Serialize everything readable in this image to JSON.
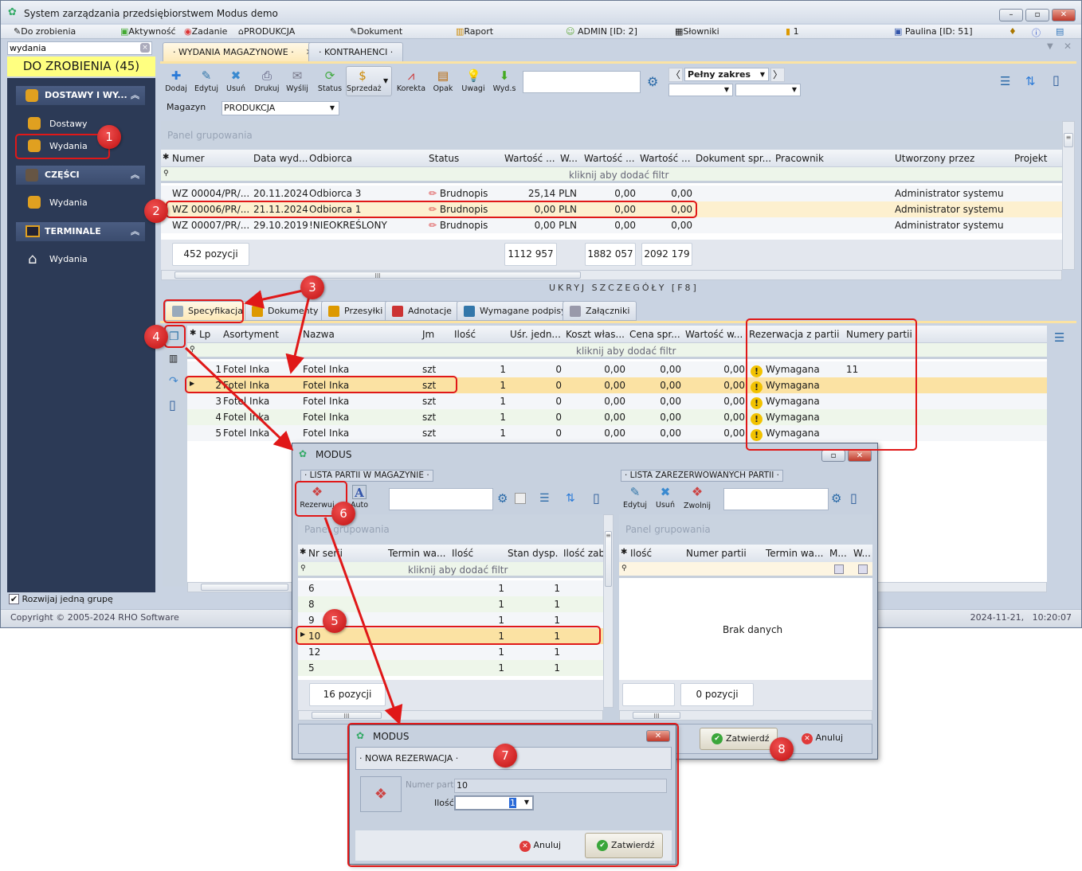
{
  "app": {
    "title": "System zarządzania przedsiębiorstwem Modus demo"
  },
  "menubar": {
    "items": [
      "Do zrobienia",
      "Aktywność",
      "Zadanie",
      "PRODUKCJA",
      "Dokument",
      "Raport",
      "ADMIN [ID: 2]",
      "Słowniki",
      "1",
      "Paulina [ID: 51]"
    ]
  },
  "sidebar": {
    "search_value": "wydania",
    "todo": "DO ZROBIENIA (45)",
    "groups": [
      {
        "label": "DOSTAWY I WY...",
        "items": [
          "Dostawy",
          "Wydania"
        ]
      },
      {
        "label": "CZĘŚCI",
        "items": [
          "Wydania"
        ]
      },
      {
        "label": "TERMINALE",
        "items": [
          "Wydania"
        ]
      }
    ],
    "expand_one_group": "Rozwijaj jedną grupę",
    "expand_one_group_checked": true
  },
  "status": {
    "copyright": "Copyright © 2005-2024 RHO Software",
    "datetime": "2024-11-21,   10:20:07"
  },
  "tabs": [
    "· WYDANIA MAGAZYNOWE ·",
    "· KONTRAHENCI ·"
  ],
  "toolbar": {
    "buttons": [
      "Dodaj",
      "Edytuj",
      "Usuń",
      "Drukuj",
      "Wyślij",
      "Status",
      "Sprzedaż",
      "Korekta",
      "Opak",
      "Uwagi",
      "Wyd.s"
    ],
    "search_value": "",
    "range": "Pełny zakres",
    "magazyn_label": "Magazyn",
    "magazyn_value": "PRODUKCJA"
  },
  "main_grid": {
    "group_panel": "Panel grupowania",
    "filter_hint": "kliknij aby dodać filtr",
    "columns": [
      "Numer",
      "Data wyd...",
      "Odbiorca",
      "Status",
      "Wartość ...",
      "W...",
      "Wartość ...",
      "Wartość ...",
      "Dokument spr...",
      "Pracownik",
      "Utworzony przez",
      "Projekt"
    ],
    "rows": [
      {
        "numer": "WZ 00004/PR/...",
        "data": "20.11.2024",
        "odbiorca": "Odbiorca 3",
        "status": "Brudnopis",
        "w1": "25,14 PLN",
        "w2": "0,00",
        "w3": "0,00",
        "utworzony": "Administrator systemu"
      },
      {
        "numer": "WZ 00006/PR/...",
        "data": "21.11.2024",
        "odbiorca": "Odbiorca 1",
        "status": "Brudnopis",
        "w1": "0,00 PLN",
        "w2": "0,00",
        "w3": "0,00",
        "utworzony": "Administrator systemu",
        "selected": true
      },
      {
        "numer": "WZ 00007/PR/...",
        "data": "29.10.2019",
        "odbiorca": "!NIEOKREŚLONY",
        "status": "Brudnopis",
        "w1": "0,00 PLN",
        "w2": "0,00",
        "w3": "0,00",
        "utworzony": "Administrator systemu"
      }
    ],
    "footer": {
      "count": "452 pozycji",
      "sum1": "1112 957",
      "sum2": "1882 057",
      "sum3": "2092 179"
    },
    "hide_details": "UKRYJ SZCZEGÓŁY [F8]"
  },
  "detail_tabs": [
    "Specyfikacja",
    "Dokumenty",
    "Przesyłki",
    "Adnotacje",
    "Wymagane podpisy",
    "Załączniki"
  ],
  "detail_grid": {
    "filter_hint": "kliknij aby dodać filtr",
    "columns": [
      "Lp",
      "Asortyment",
      "Nazwa",
      "Jm",
      "Ilość",
      "Uśr. jedn...",
      "Koszt włas...",
      "Cena spr...",
      "Wartość w...",
      "Rezerwacja z partii",
      "Numery partii"
    ],
    "rows": [
      {
        "lp": "1",
        "asort": "Fotel Inka",
        "nazwa": "Fotel Inka",
        "jm": "szt",
        "ilosc": "1",
        "usr": "0",
        "koszt": "0,00",
        "cena": "0,00",
        "wart": "0,00",
        "rez": "Wymagana",
        "partie": "11"
      },
      {
        "lp": "2",
        "asort": "Fotel Inka",
        "nazwa": "Fotel Inka",
        "jm": "szt",
        "ilosc": "1",
        "usr": "0",
        "koszt": "0,00",
        "cena": "0,00",
        "wart": "0,00",
        "rez": "Wymagana",
        "partie": "",
        "selected": true
      },
      {
        "lp": "3",
        "asort": "Fotel Inka",
        "nazwa": "Fotel Inka",
        "jm": "szt",
        "ilosc": "1",
        "usr": "0",
        "koszt": "0,00",
        "cena": "0,00",
        "wart": "0,00",
        "rez": "Wymagana",
        "partie": ""
      },
      {
        "lp": "4",
        "asort": "Fotel Inka",
        "nazwa": "Fotel Inka",
        "jm": "szt",
        "ilosc": "1",
        "usr": "0",
        "koszt": "0,00",
        "cena": "0,00",
        "wart": "0,00",
        "rez": "Wymagana",
        "partie": ""
      },
      {
        "lp": "5",
        "asort": "Fotel Inka",
        "nazwa": "Fotel Inka",
        "jm": "szt",
        "ilosc": "1",
        "usr": "0",
        "koszt": "0,00",
        "cena": "0,00",
        "wart": "0,00",
        "rez": "Wymagana",
        "partie": ""
      }
    ]
  },
  "dialog_partie": {
    "title": "MODUS",
    "left": {
      "section": "· LISTA PARTII W MAGAZYNIE ·",
      "buttons": [
        "Rezerwuj",
        "Auto"
      ],
      "group_panel": "Panel grupowania",
      "filter_hint": "kliknij aby dodać filtr",
      "columns": [
        "Nr serii",
        "Termin wa...",
        "Ilość",
        "Stan dysp.",
        "Ilość zab"
      ],
      "rows": [
        {
          "nr": "6",
          "ilosc": "1",
          "stan": "1"
        },
        {
          "nr": "8",
          "ilosc": "1",
          "stan": "1"
        },
        {
          "nr": "9",
          "ilosc": "1",
          "stan": "1"
        },
        {
          "nr": "10",
          "ilosc": "1",
          "stan": "1",
          "selected": true
        },
        {
          "nr": "12",
          "ilosc": "1",
          "stan": "1"
        },
        {
          "nr": "5",
          "ilosc": "1",
          "stan": "1"
        }
      ],
      "footer": "16 pozycji"
    },
    "right": {
      "section": "· LISTA ZAREZERWOWANYCH PARTII ·",
      "buttons": [
        "Edytuj",
        "Usuń",
        "Zwolnij"
      ],
      "group_panel": "Panel grupowania",
      "columns": [
        "Ilość",
        "Numer partii",
        "Termin wa...",
        "M...",
        "W..."
      ],
      "empty": "Brak danych",
      "footer": "0 pozycji"
    },
    "confirm": "Zatwierdź",
    "cancel": "Anuluj"
  },
  "dialog_rezerwacja": {
    "title": "MODUS",
    "section": "· NOWA REZERWACJA ·",
    "numer_partii_label": "Numer partii",
    "numer_partii_value": "10",
    "ilosc_label": "Ilość",
    "ilosc_value": "1",
    "cancel": "Anuluj",
    "confirm": "Zatwierdź"
  },
  "annotations": [
    "1",
    "2",
    "3",
    "4",
    "5",
    "6",
    "7",
    "8"
  ],
  "colors": {
    "accent_red": "#e01818",
    "sidebar": "#2c3a56",
    "todo_bg": "#ffff80",
    "selected_row": "#fbe2a3"
  }
}
